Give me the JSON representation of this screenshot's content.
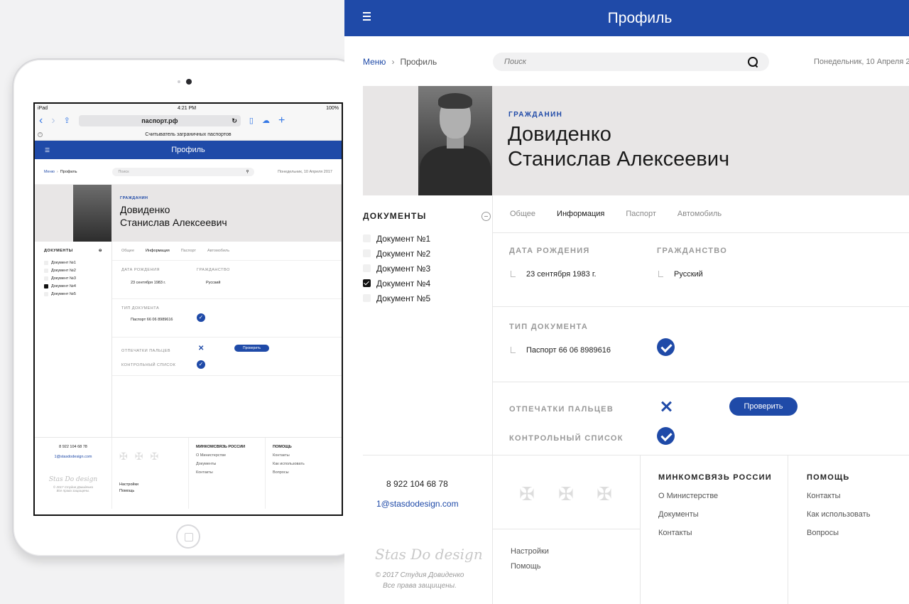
{
  "ipad": {
    "status_left": "iPad",
    "status_time": "4:21 PM",
    "status_battery": "100%",
    "url": "паспорт.рф",
    "tab_title": "Считыватель заграничных паспортов"
  },
  "header": {
    "title": "Профиль"
  },
  "breadcrumb": {
    "menu": "Меню",
    "current": "Профиль"
  },
  "search": {
    "placeholder": "Поиск"
  },
  "date": "Понедельник, 10 Апреля 2017",
  "date_mobile": "Понедельник, 10 Апреля 2017",
  "profile": {
    "label": "ГРАЖДАНИН",
    "last_name": "Довиденко",
    "first_names": "Станислав Алексеевич"
  },
  "documents": {
    "title": "ДОКУМЕНТЫ",
    "items": [
      {
        "label": "Документ №1",
        "checked": false
      },
      {
        "label": "Документ №2",
        "checked": false
      },
      {
        "label": "Документ №3",
        "checked": false
      },
      {
        "label": "Документ №4",
        "checked": true
      },
      {
        "label": "Документ №5",
        "checked": false
      }
    ]
  },
  "tabs": [
    "Общее",
    "Информация",
    "Паспорт",
    "Автомобиль"
  ],
  "info": {
    "birth_label": "ДАТА РОЖДЕНИЯ",
    "birth_value": "23 сентября 1983 г.",
    "citizenship_label": "ГРАЖДАНСТВО",
    "citizenship_value": "Русский",
    "doc_type_label": "ТИП ДОКУМЕНТА",
    "doc_type_value": "Паспорт 66 06  8989616",
    "fingerprints_label": "ОТПЕЧАТКИ ПАЛЬЦЕВ",
    "watchlist_label": "КОНТРОЛЬНЫЙ СПИСОК",
    "verify_button": "Проверить"
  },
  "footer": {
    "phone": "8 922 104 68 78",
    "email": "1@stasdodesign.com",
    "logo": "Stas Do design",
    "copyright_line1": "© 2017  Студия Довиденко",
    "copyright_line2": "Все права защищены.",
    "settings": "Настройки",
    "help": "Помощь",
    "ministry_title": "МИНКОМСВЯЗЬ РОССИИ",
    "ministry_links": [
      "О Министерстве",
      "Документы",
      "Контакты"
    ],
    "help_title": "ПОМОЩЬ",
    "help_links": [
      "Контакты",
      "Как использовать",
      "Вопросы"
    ]
  },
  "colors": {
    "brand": "#1f4aa8",
    "hero_bg": "#e8e6e6"
  }
}
